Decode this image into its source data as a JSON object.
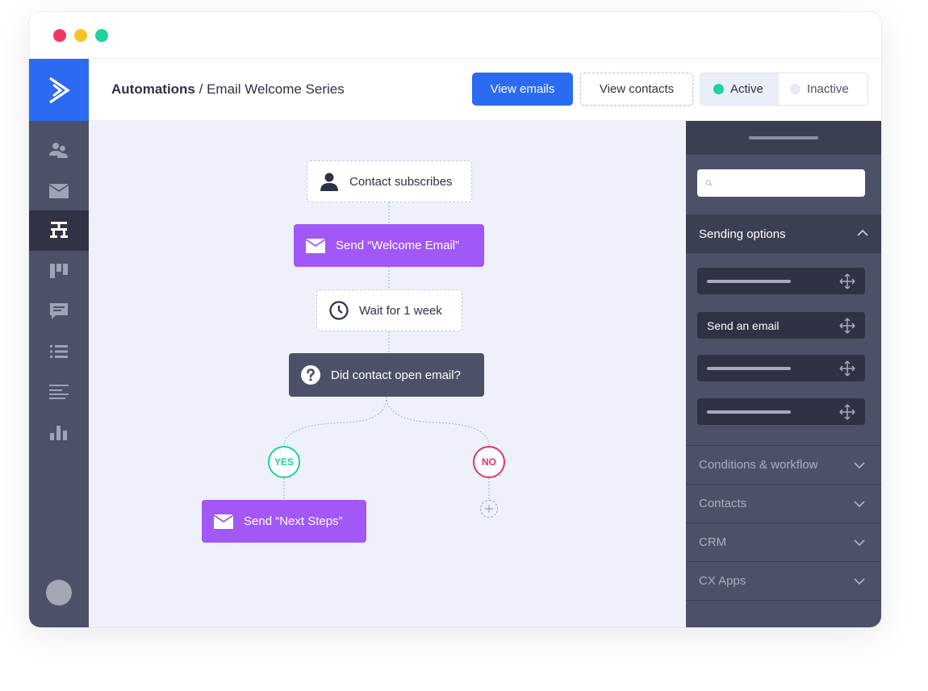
{
  "window": {
    "traffic_lights": [
      "#f6345f",
      "#f8c424",
      "#1dd3a0"
    ]
  },
  "sidebar": {
    "logo_icon": "chevron-right-logo-icon",
    "items": [
      {
        "icon": "contacts-icon",
        "active": false
      },
      {
        "icon": "mail-icon",
        "active": false
      },
      {
        "icon": "automations-icon",
        "active": true
      },
      {
        "icon": "pipeline-icon",
        "active": false
      },
      {
        "icon": "conversations-icon",
        "active": false
      },
      {
        "icon": "lists-icon",
        "active": false
      },
      {
        "icon": "forms-icon",
        "active": false
      },
      {
        "icon": "reports-icon",
        "active": false
      }
    ],
    "avatar_icon": "avatar"
  },
  "header": {
    "breadcrumb_root": "Automations",
    "breadcrumb_sep": " / ",
    "breadcrumb_current": "Email Welcome Series",
    "view_emails_label": "View emails",
    "view_contacts_label": "View contacts",
    "status_active_label": "Active",
    "status_inactive_label": "Inactive",
    "status_selected": "Active"
  },
  "workflow": {
    "start_trigger": "Contact subscribes",
    "send_email_1": "Send “Welcome Email”",
    "wait": "Wait for 1 week",
    "condition": "Did contact open email?",
    "yes_label": "YES",
    "no_label": "NO",
    "send_email_2": "Send “Next Steps”",
    "add_step_icon": "plus-icon"
  },
  "panel": {
    "search_placeholder": "",
    "sending_options_label": "Sending options",
    "sending_items": [
      "",
      "Send an email",
      "",
      ""
    ],
    "sections": [
      "Conditions & workflow",
      "Contacts",
      "CRM",
      "CX Apps"
    ]
  },
  "colors": {
    "primary": "#2a6bf2",
    "email_node": "#a158f7",
    "condition_node": "#4c5167",
    "sidebar": "#4c5167",
    "canvas": "#eef1f9",
    "yes": "#1dd3a0",
    "no": "#e0336b"
  }
}
